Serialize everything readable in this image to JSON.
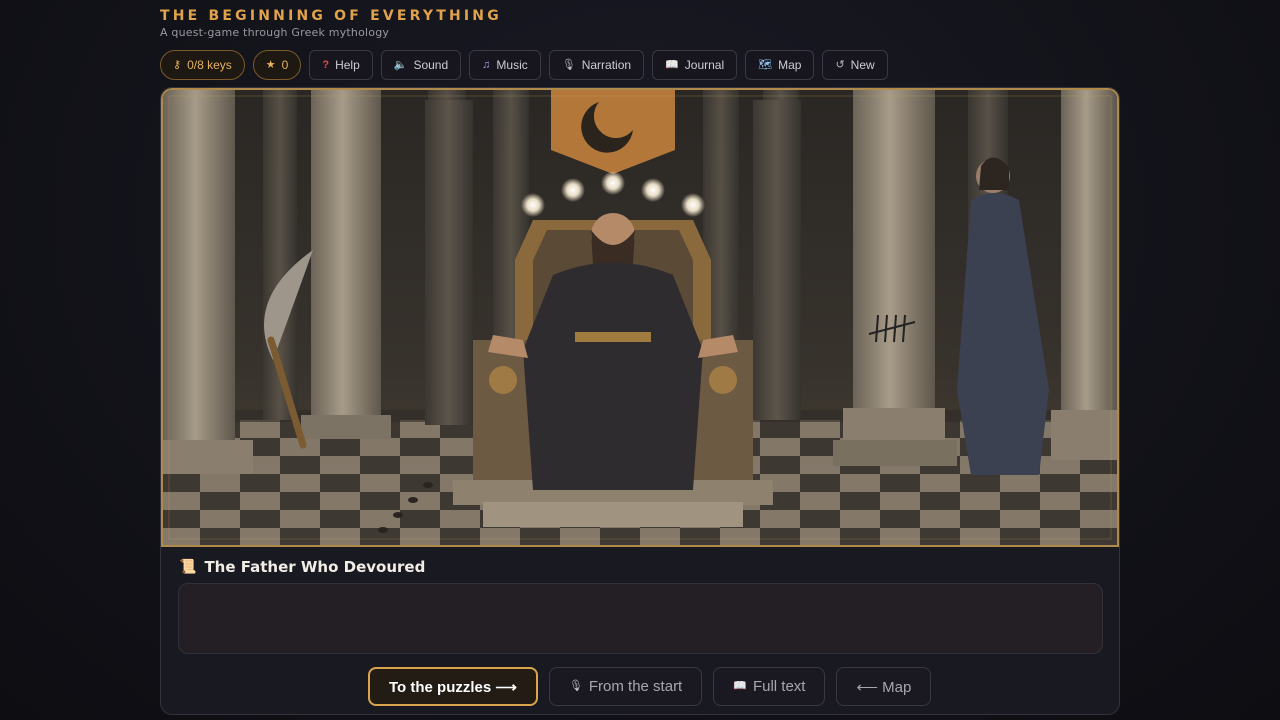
{
  "header": {
    "title": "THE BEGINNING OF EVERYTHING",
    "subtitle": "A quest-game through Greek mythology"
  },
  "toolbar": {
    "keys": {
      "icon": "key-icon",
      "glyph": "⚷",
      "label": "0/8 keys"
    },
    "stars": {
      "icon": "star-icon",
      "glyph": "★",
      "label": "0"
    },
    "help": {
      "icon": "question-icon",
      "glyph": "?",
      "label": "Help"
    },
    "sound": {
      "icon": "speaker-icon",
      "glyph": "🔈",
      "label": "Sound"
    },
    "music": {
      "icon": "music-note-icon",
      "glyph": "♫",
      "label": "Music"
    },
    "narration": {
      "icon": "microphone-icon",
      "glyph": "🎙",
      "label": "Narration"
    },
    "journal": {
      "icon": "book-icon",
      "glyph": "📖",
      "label": "Journal"
    },
    "map": {
      "icon": "map-icon",
      "glyph": "🗺",
      "label": "Map"
    },
    "new_game": {
      "icon": "restart-icon",
      "glyph": "↺",
      "label": "New"
    }
  },
  "scene": {
    "description_alt": "Kronos on a stone throne in a pillared hall with a sickle and Rhea",
    "orb_count": 5
  },
  "chapter": {
    "icon": "scroll-icon",
    "glyph": "📜",
    "title": "The Father Who Devoured",
    "text": ""
  },
  "actions": {
    "puzzles": {
      "label": "To the puzzles ⟶"
    },
    "from_start": {
      "icon": "microphone-icon",
      "glyph": "🎙",
      "label": "From the start"
    },
    "full_text": {
      "icon": "book-icon",
      "glyph": "📖",
      "label": "Full text"
    },
    "back_map": {
      "label": "⟵ Map"
    }
  },
  "colors": {
    "accent": "#e0a24a",
    "scene_border": "#b08a4a",
    "background": "#121219"
  }
}
